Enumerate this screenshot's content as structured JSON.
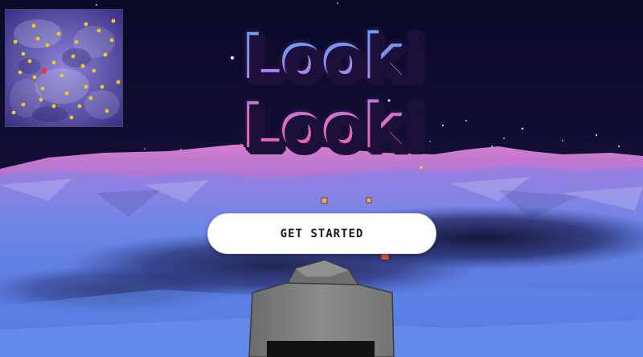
{
  "logo": {
    "line1": "Looki",
    "line2": "Looki"
  },
  "cta": {
    "label": "GET STARTED"
  },
  "minimap": {
    "player_color": "#e53935",
    "pickup_color": "#f6c61f"
  },
  "colors": {
    "sky": "#0d0a2a",
    "terrain_far": "#c26ac8",
    "terrain_near": "#5a7fe0",
    "button_bg": "#ffffff"
  }
}
